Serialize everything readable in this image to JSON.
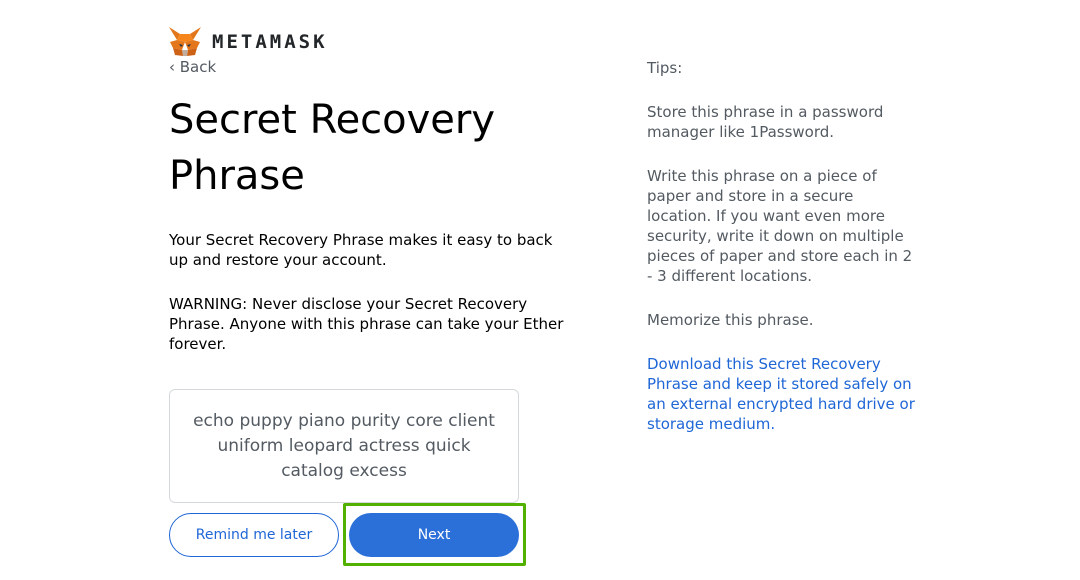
{
  "brand": {
    "wordmark": "METAMASK",
    "logo_icon": "metamask-fox-icon"
  },
  "nav": {
    "back_label": "‹ Back"
  },
  "main": {
    "title": "Secret Recovery Phrase",
    "description": "Your Secret Recovery Phrase makes it easy to back up and restore your account.",
    "warning": "WARNING: Never disclose your Secret Recovery Phrase. Anyone with this phrase can take your Ether forever.",
    "phrase": "echo puppy piano purity core client uniform leopard actress quick catalog excess"
  },
  "actions": {
    "remind_label": "Remind me later",
    "next_label": "Next"
  },
  "tips": {
    "heading": "Tips:",
    "tip1": "Store this phrase in a password manager like 1Password.",
    "tip2": "Write this phrase on a piece of paper and store in a secure location. If you want even more security, write it down on multiple pieces of paper and store each in 2 - 3 different locations.",
    "tip3": "Memorize this phrase.",
    "download_link": "Download this Secret Recovery Phrase and keep it stored safely on an external encrypted hard drive or storage medium."
  },
  "colors": {
    "accent": "#2b6fd9",
    "link": "#1f66d6",
    "highlight": "#52b000",
    "muted_text": "#535a61"
  }
}
